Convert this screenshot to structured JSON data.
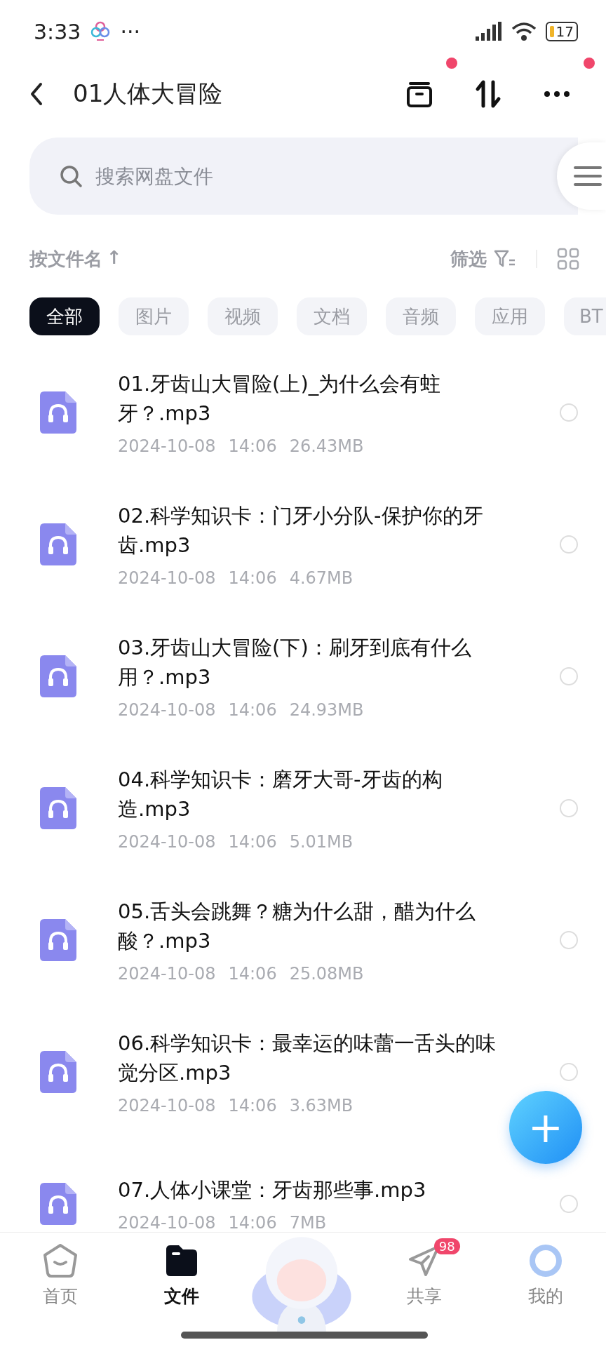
{
  "status_bar": {
    "time": "3:33",
    "more": "···",
    "battery": "17"
  },
  "header": {
    "title": "01人体大冒险",
    "actions": [
      {
        "kind": "archive",
        "badge": true
      },
      {
        "kind": "sort",
        "badge": false
      },
      {
        "kind": "more",
        "badge": true
      }
    ]
  },
  "search": {
    "placeholder": "搜索网盘文件"
  },
  "sort_bar": {
    "label": "按文件名",
    "arrow": "↑",
    "filter": "筛选"
  },
  "chips": [
    {
      "label": "全部",
      "selected": true
    },
    {
      "label": "图片",
      "selected": false
    },
    {
      "label": "视频",
      "selected": false
    },
    {
      "label": "文档",
      "selected": false
    },
    {
      "label": "音频",
      "selected": false
    },
    {
      "label": "应用",
      "selected": false
    },
    {
      "label": "BT",
      "selected": false
    }
  ],
  "files": [
    {
      "title": "01.牙齿山大冒险(上)_为什么会有蛀牙？.mp3",
      "date": "2024-10-08",
      "time": "14:06",
      "size": "26.43MB",
      "selected": false
    },
    {
      "title": "02.科学知识卡：门牙小分队-保护你的牙齿.mp3",
      "date": "2024-10-08",
      "time": "14:06",
      "size": "4.67MB",
      "selected": false
    },
    {
      "title": "03.牙齿山大冒险(下)：刷牙到底有什么用？.mp3",
      "date": "2024-10-08",
      "time": "14:06",
      "size": "24.93MB",
      "selected": false
    },
    {
      "title": "04.科学知识卡：磨牙大哥-牙齿的构造.mp3",
      "date": "2024-10-08",
      "time": "14:06",
      "size": "5.01MB",
      "selected": false
    },
    {
      "title": "05.舌头会跳舞？糖为什么甜，醋为什么酸？.mp3",
      "date": "2024-10-08",
      "time": "14:06",
      "size": "25.08MB",
      "selected": false
    },
    {
      "title": "06.科学知识卡：最幸运的味蕾一舌头的味觉分区.mp3",
      "date": "2024-10-08",
      "time": "14:06",
      "size": "3.63MB",
      "selected": false
    },
    {
      "title": "07.人体小课堂：牙齿那些事.mp3",
      "date": "2024-10-08",
      "time": "14:06",
      "size": "7MB",
      "selected": false
    }
  ],
  "fab": {
    "label": "+"
  },
  "bottom_nav": [
    {
      "kind": "home",
      "label": "首页",
      "selected": false
    },
    {
      "kind": "files",
      "label": "文件",
      "selected": true
    },
    {
      "kind": "mascot"
    },
    {
      "kind": "share",
      "label": "共享",
      "selected": false,
      "badge": "98"
    },
    {
      "kind": "me",
      "label": "我的",
      "selected": false
    }
  ]
}
